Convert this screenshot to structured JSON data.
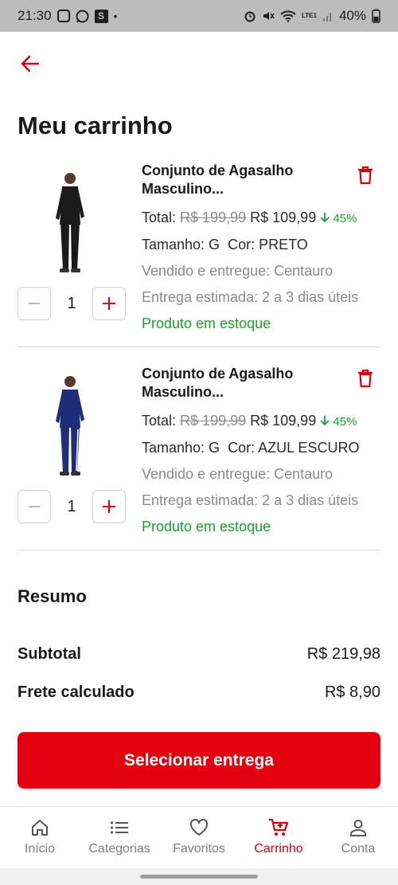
{
  "status_bar": {
    "time": "21:30",
    "battery": "40%",
    "net_label": "LTE1",
    "extra_dot": "•"
  },
  "title": "Meu carrinho",
  "items": [
    {
      "name": "Conjunto de Agasalho Masculino...",
      "total_label": "Total:",
      "old_price": "R$ 199,99",
      "price": "R$ 109,99",
      "discount": "45%",
      "size_label": "Tamanho: G",
      "color_label": "Cor: PRETO",
      "seller": "Vendido e entregue: Centauro",
      "delivery": "Entrega estimada:  2 a 3 dias úteis",
      "stock": "Produto em estoque",
      "qty": "1",
      "tracksuit_color": "#1b1b1b"
    },
    {
      "name": "Conjunto de Agasalho Masculino...",
      "total_label": "Total:",
      "old_price": "R$ 199,99",
      "price": "R$ 109,99",
      "discount": "45%",
      "size_label": "Tamanho: G",
      "color_label": "Cor: AZUL ESCURO",
      "seller": "Vendido e entregue: Centauro",
      "delivery": "Entrega estimada:  2 a 3 dias úteis",
      "stock": "Produto em estoque",
      "qty": "1",
      "tracksuit_color": "#1f2e78"
    }
  ],
  "summary": {
    "title": "Resumo",
    "subtotal_label": "Subtotal",
    "subtotal_value": "R$ 219,98",
    "shipping_label": "Frete calculado",
    "shipping_value": "R$ 8,90"
  },
  "cta_label": "Selecionar entrega",
  "nav": [
    {
      "label": "Início",
      "icon": "home-icon"
    },
    {
      "label": "Categorias",
      "icon": "list-icon"
    },
    {
      "label": "Favoritos",
      "icon": "heart-icon"
    },
    {
      "label": "Carrinho",
      "icon": "cart-icon",
      "active": true
    },
    {
      "label": "Conta",
      "icon": "user-icon"
    }
  ],
  "colors": {
    "accent": "#e3000f",
    "green": "#19a02b",
    "gray_text": "#8a8a8a"
  }
}
